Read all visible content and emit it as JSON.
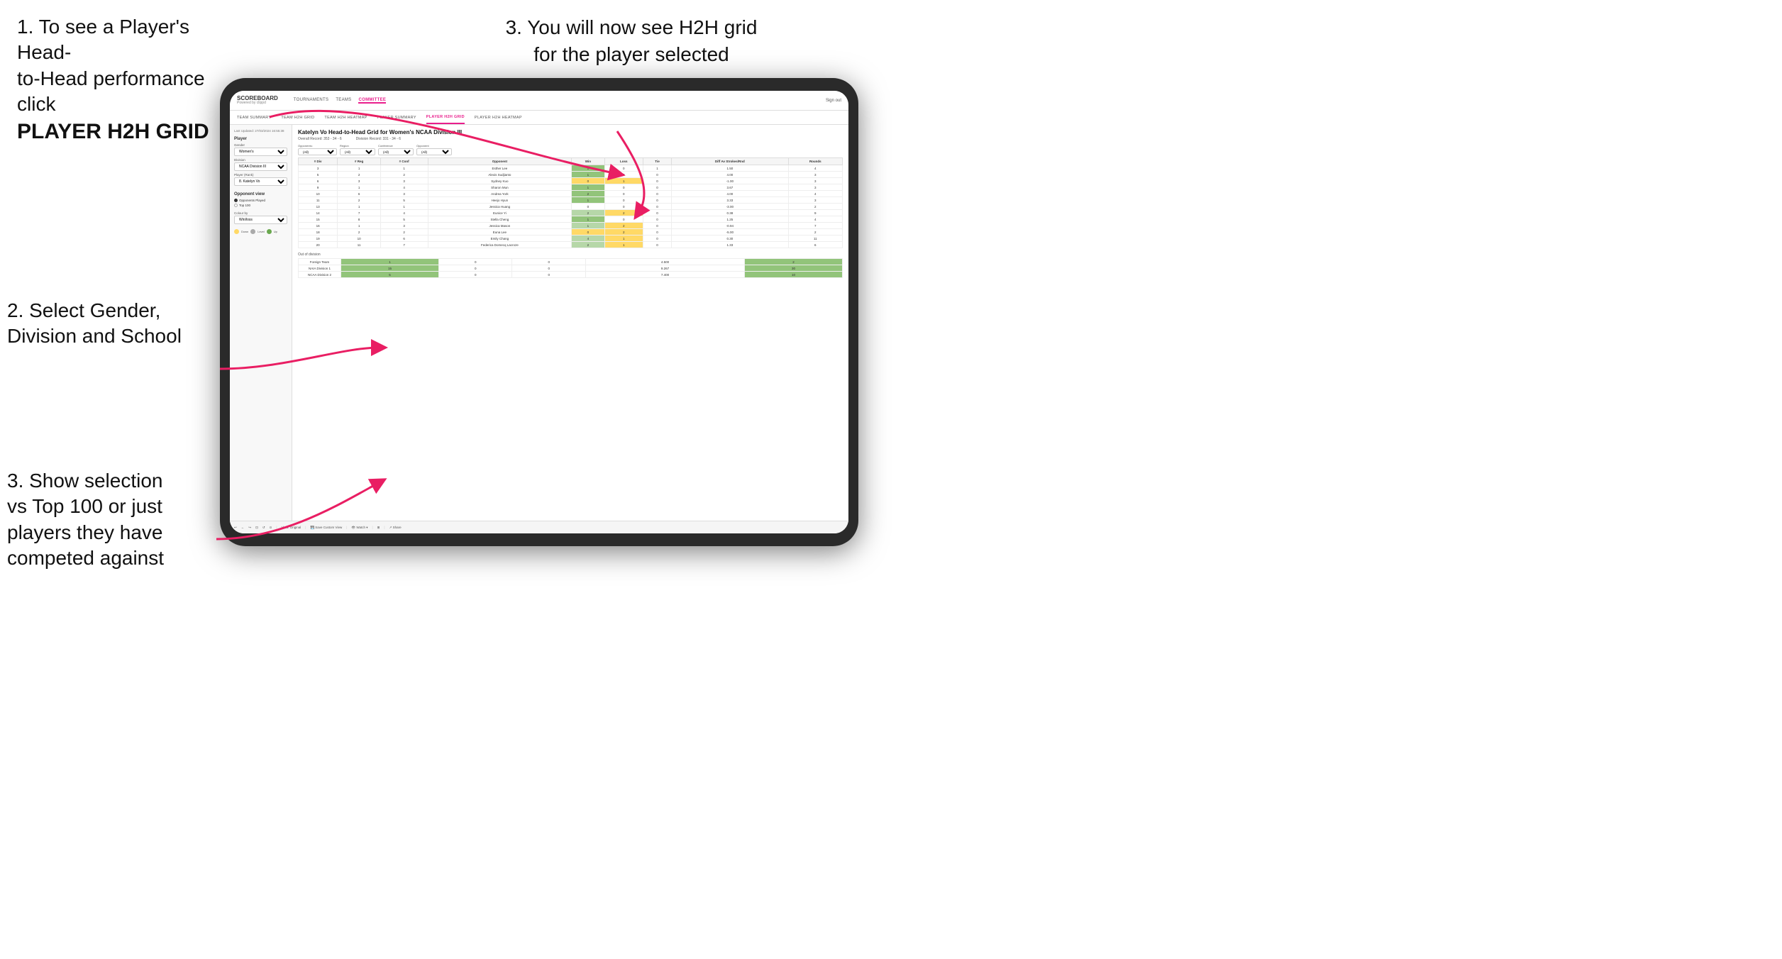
{
  "instructions": {
    "step1_line1": "1. To see a Player's Head-",
    "step1_line2": "to-Head performance click",
    "step1_bold": "PLAYER H2H GRID",
    "step2": "2. Select Gender, Division and School",
    "step3_top_line1": "3. You will now see H2H grid",
    "step3_top_line2": "for the player selected",
    "step3_bottom_line1": "3. Show selection",
    "step3_bottom_line2": "vs Top 100 or just",
    "step3_bottom_line3": "players they have",
    "step3_bottom_line4": "competed against"
  },
  "nav": {
    "logo": "SCOREBOARD",
    "logo_sub": "Powered by clippd",
    "links": [
      "TOURNAMENTS",
      "TEAMS",
      "COMMITTEE"
    ],
    "active_link": "COMMITTEE",
    "sign_out": "Sign out"
  },
  "sub_nav": {
    "items": [
      "TEAM SUMMARY",
      "TEAM H2H GRID",
      "TEAM H2H HEATMAP",
      "PLAYER SUMMARY",
      "PLAYER H2H GRID",
      "PLAYER H2H HEATMAP"
    ],
    "active": "PLAYER H2H GRID"
  },
  "left_panel": {
    "timestamp": "Last Updated: 27/03/2024 16:55:38",
    "player_label": "Player",
    "gender_label": "Gender",
    "gender_value": "Women's",
    "division_label": "Division",
    "division_value": "NCAA Division III",
    "player_rank_label": "Player (Rank)",
    "player_rank_value": "8. Katelyn Vo",
    "opponent_view_label": "Opponent view",
    "radio_options": [
      "Opponents Played",
      "Top 100"
    ],
    "radio_selected": "Opponents Played",
    "colour_by_label": "Colour by",
    "colour_by_value": "Win/loss",
    "legend": [
      {
        "color": "#ffd966",
        "label": "Down"
      },
      {
        "color": "#aaaaaa",
        "label": "Level"
      },
      {
        "color": "#6aa84f",
        "label": "Up"
      }
    ]
  },
  "grid": {
    "title": "Katelyn Vo Head-to-Head Grid for Women's NCAA Division III",
    "overall_record": "Overall Record: 353 - 34 - 6",
    "division_record": "Division Record: 331 - 34 - 6",
    "filters": {
      "opponents_label": "Opponents:",
      "opponents_value": "(All)",
      "region_label": "Region",
      "region_value": "(All)",
      "conference_label": "Conference",
      "conference_value": "(All)",
      "opponent_label": "Opponent",
      "opponent_value": "(All)"
    },
    "columns": [
      "# Div",
      "# Reg",
      "# Conf",
      "Opponent",
      "Win",
      "Loss",
      "Tie",
      "Diff Av Strokes/Rnd",
      "Rounds"
    ],
    "rows": [
      {
        "div": "3",
        "reg": "1",
        "conf": "1",
        "opponent": "Esther Lee",
        "win": "1",
        "loss": "0",
        "tie": "1",
        "diff": "1.50",
        "rounds": "4"
      },
      {
        "div": "5",
        "reg": "2",
        "conf": "2",
        "opponent": "Alexis Sudjianto",
        "win": "1",
        "loss": "0",
        "tie": "0",
        "diff": "4.00",
        "rounds": "3"
      },
      {
        "div": "6",
        "reg": "3",
        "conf": "3",
        "opponent": "Sydney Kuo",
        "win": "0",
        "loss": "1",
        "tie": "0",
        "diff": "-1.00",
        "rounds": "3"
      },
      {
        "div": "9",
        "reg": "1",
        "conf": "4",
        "opponent": "Sharon Mun",
        "win": "1",
        "loss": "0",
        "tie": "0",
        "diff": "3.67",
        "rounds": "3"
      },
      {
        "div": "10",
        "reg": "6",
        "conf": "3",
        "opponent": "Andrea York",
        "win": "2",
        "loss": "0",
        "tie": "0",
        "diff": "4.00",
        "rounds": "4"
      },
      {
        "div": "11",
        "reg": "2",
        "conf": "5",
        "opponent": "Heejo Hyun",
        "win": "1",
        "loss": "0",
        "tie": "0",
        "diff": "3.33",
        "rounds": "3"
      },
      {
        "div": "13",
        "reg": "1",
        "conf": "1",
        "opponent": "Jessica Huang",
        "win": "0",
        "loss": "0",
        "tie": "0",
        "diff": "-3.00",
        "rounds": "2"
      },
      {
        "div": "14",
        "reg": "7",
        "conf": "4",
        "opponent": "Eunice Yi",
        "win": "2",
        "loss": "2",
        "tie": "0",
        "diff": "0.38",
        "rounds": "9"
      },
      {
        "div": "15",
        "reg": "8",
        "conf": "5",
        "opponent": "Stella Cheng",
        "win": "1",
        "loss": "0",
        "tie": "0",
        "diff": "1.25",
        "rounds": "4"
      },
      {
        "div": "16",
        "reg": "1",
        "conf": "3",
        "opponent": "Jessica Mason",
        "win": "1",
        "loss": "2",
        "tie": "0",
        "diff": "-0.94",
        "rounds": "7"
      },
      {
        "div": "18",
        "reg": "2",
        "conf": "2",
        "opponent": "Euna Lee",
        "win": "0",
        "loss": "2",
        "tie": "0",
        "diff": "-5.00",
        "rounds": "2"
      },
      {
        "div": "19",
        "reg": "10",
        "conf": "6",
        "opponent": "Emily Chang",
        "win": "4",
        "loss": "1",
        "tie": "0",
        "diff": "0.30",
        "rounds": "11"
      },
      {
        "div": "20",
        "reg": "11",
        "conf": "7",
        "opponent": "Federica Domecq Lacroze",
        "win": "2",
        "loss": "1",
        "tie": "0",
        "diff": "1.33",
        "rounds": "6"
      }
    ],
    "out_of_division_label": "Out of division",
    "out_of_division_rows": [
      {
        "label": "Foreign Team",
        "win": "1",
        "loss": "0",
        "tie": "0",
        "diff": "4.500",
        "rounds": "2"
      },
      {
        "label": "NAIA Division 1",
        "win": "15",
        "loss": "0",
        "tie": "0",
        "diff": "9.267",
        "rounds": "30"
      },
      {
        "label": "NCAA Division 2",
        "win": "5",
        "loss": "0",
        "tie": "0",
        "diff": "7.400",
        "rounds": "10"
      }
    ]
  },
  "toolbar": {
    "items": [
      "↩",
      "←",
      "↪",
      "⊡",
      "↩·",
      "⊙",
      "View: Original",
      "Save Custom View",
      "👁 Watch ▾",
      "⊞",
      "↗ Share"
    ]
  }
}
